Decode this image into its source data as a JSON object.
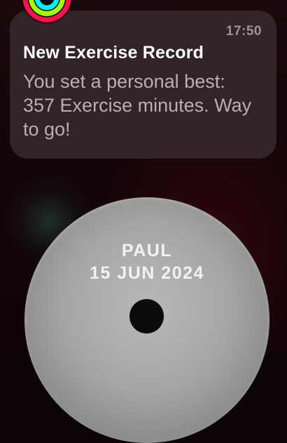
{
  "notification": {
    "time": "17:50",
    "title": "New Exercise Record",
    "message": "You set a personal best: 357 Exercise minutes. Way to go!",
    "app_icon": "activity-rings-icon"
  },
  "award_disc": {
    "name": "PAUL",
    "date": "15 JUN 2024"
  },
  "colors": {
    "move_ring": "#fa114f",
    "exercise_ring": "#a6ff00",
    "stand_ring": "#00f0ff",
    "card_bg": "#3a2c30",
    "disc": "#a6a6a6"
  }
}
